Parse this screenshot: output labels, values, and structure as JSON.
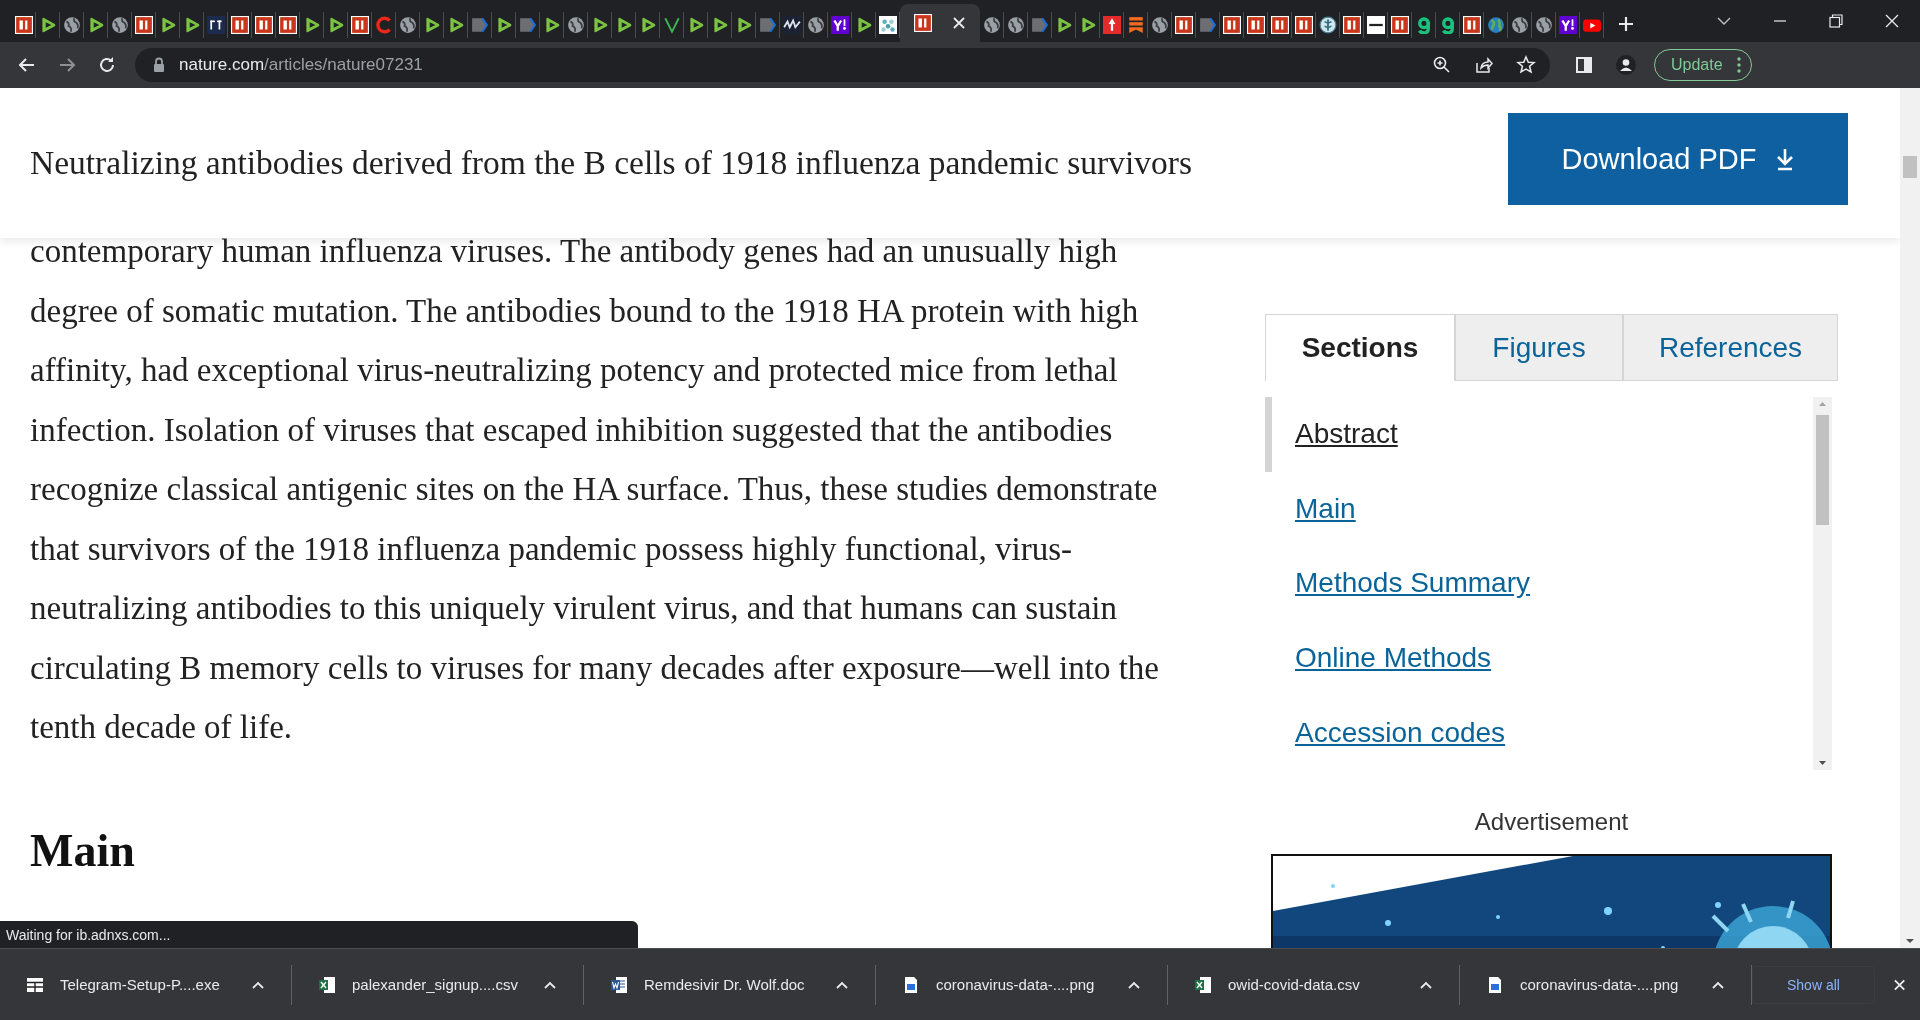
{
  "browser": {
    "tabs": [
      {
        "kind": "bi",
        "selected": false
      },
      {
        "kind": "play",
        "selected": false
      },
      {
        "kind": "globe",
        "selected": false
      },
      {
        "kind": "play",
        "selected": false
      },
      {
        "kind": "globe",
        "selected": false
      },
      {
        "kind": "bi",
        "selected": false
      },
      {
        "kind": "play",
        "selected": false
      },
      {
        "kind": "play",
        "selected": false
      },
      {
        "kind": "et",
        "selected": false
      },
      {
        "kind": "bi",
        "selected": false
      },
      {
        "kind": "bi",
        "selected": false
      },
      {
        "kind": "bi",
        "selected": false
      },
      {
        "kind": "play",
        "selected": false
      },
      {
        "kind": "play",
        "selected": false
      },
      {
        "kind": "bi",
        "selected": false
      },
      {
        "kind": "ring",
        "selected": false
      },
      {
        "kind": "globe",
        "selected": false
      },
      {
        "kind": "play",
        "selected": false
      },
      {
        "kind": "play",
        "selected": false
      },
      {
        "kind": "chevron",
        "selected": false
      },
      {
        "kind": "play",
        "selected": false
      },
      {
        "kind": "chevron",
        "selected": false
      },
      {
        "kind": "play",
        "selected": false
      },
      {
        "kind": "globe",
        "selected": false
      },
      {
        "kind": "play",
        "selected": false
      },
      {
        "kind": "play",
        "selected": false
      },
      {
        "kind": "play",
        "selected": false
      },
      {
        "kind": "vee",
        "selected": false
      },
      {
        "kind": "play",
        "selected": false
      },
      {
        "kind": "play",
        "selected": false
      },
      {
        "kind": "play",
        "selected": false
      },
      {
        "kind": "chevron",
        "selected": false
      },
      {
        "kind": "chart",
        "selected": false
      },
      {
        "kind": "globe",
        "selected": false
      },
      {
        "kind": "yahoo",
        "selected": false
      },
      {
        "kind": "play",
        "selected": false
      },
      {
        "kind": "checker",
        "selected": false
      },
      {
        "kind": "bi",
        "selected": true
      },
      {
        "kind": "globe",
        "selected": false
      },
      {
        "kind": "globe",
        "selected": false
      },
      {
        "kind": "chevron",
        "selected": false
      },
      {
        "kind": "play",
        "selected": false
      },
      {
        "kind": "play",
        "selected": false
      },
      {
        "kind": "pin",
        "selected": false
      },
      {
        "kind": "bars",
        "selected": false
      },
      {
        "kind": "globe",
        "selected": false
      },
      {
        "kind": "bi",
        "selected": false
      },
      {
        "kind": "chevron",
        "selected": false
      },
      {
        "kind": "bi",
        "selected": false
      },
      {
        "kind": "bi",
        "selected": false
      },
      {
        "kind": "bi",
        "selected": false
      },
      {
        "kind": "bi",
        "selected": false
      },
      {
        "kind": "caduceus",
        "selected": false
      },
      {
        "kind": "bi",
        "selected": false
      },
      {
        "kind": "banner",
        "selected": false
      },
      {
        "kind": "bi",
        "selected": false
      },
      {
        "kind": "hook",
        "selected": false
      },
      {
        "kind": "hook",
        "selected": false
      },
      {
        "kind": "bi",
        "selected": false
      },
      {
        "kind": "earth",
        "selected": false
      },
      {
        "kind": "globe",
        "selected": false
      },
      {
        "kind": "globe",
        "selected": false
      },
      {
        "kind": "yahoo",
        "selected": false
      },
      {
        "kind": "youtube",
        "selected": false
      }
    ]
  },
  "toolbar": {
    "url_host": "nature.com",
    "url_path": "/articles/nature07231",
    "update_button": "Update"
  },
  "article": {
    "title": "Neutralizing antibodies derived from the B cells of 1918 influenza pandemic survivors",
    "download_button": "Download PDF",
    "abstract_text": "contemporary human influenza viruses. The antibody genes had an unusually high degree of somatic mutation. The antibodies bound to the 1918 HA protein with high affinity, had exceptional virus-neutralizing potency and protected mice from lethal infection. Isolation of viruses that escaped inhibition suggested that the antibodies recognize classical antigenic sites on the HA surface. Thus, these studies demonstrate that survivors of the 1918 influenza pandemic possess highly functional, virus-neutralizing antibodies to this uniquely virulent virus, and that humans can sustain circulating B memory cells to viruses for many decades after exposure—well into the tenth decade of life.",
    "next_heading": "Main"
  },
  "sidebar": {
    "tabs": [
      {
        "label": "Sections",
        "selected": true
      },
      {
        "label": "Figures",
        "selected": false
      },
      {
        "label": "References",
        "selected": false
      }
    ],
    "sections": [
      {
        "label": "Abstract",
        "selected": true
      },
      {
        "label": "Main",
        "selected": false
      },
      {
        "label": "Methods Summary",
        "selected": false
      },
      {
        "label": "Online Methods",
        "selected": false
      },
      {
        "label": "Accession codes",
        "selected": false
      }
    ],
    "ad_label": "Advertisement"
  },
  "status_bubble": "Waiting for ib.adnxs.com...",
  "downloads": {
    "items": [
      {
        "name": "Telegram-Setup-P....exe",
        "kind": "exe"
      },
      {
        "name": "palexander_signup....csv",
        "kind": "csv"
      },
      {
        "name": "Remdesivir Dr. Wolf.doc",
        "kind": "doc"
      },
      {
        "name": "coronavirus-data-....png",
        "kind": "png"
      },
      {
        "name": "owid-covid-data.csv",
        "kind": "csv"
      },
      {
        "name": "coronavirus-data-....png",
        "kind": "png"
      }
    ],
    "show_all": "Show all"
  }
}
